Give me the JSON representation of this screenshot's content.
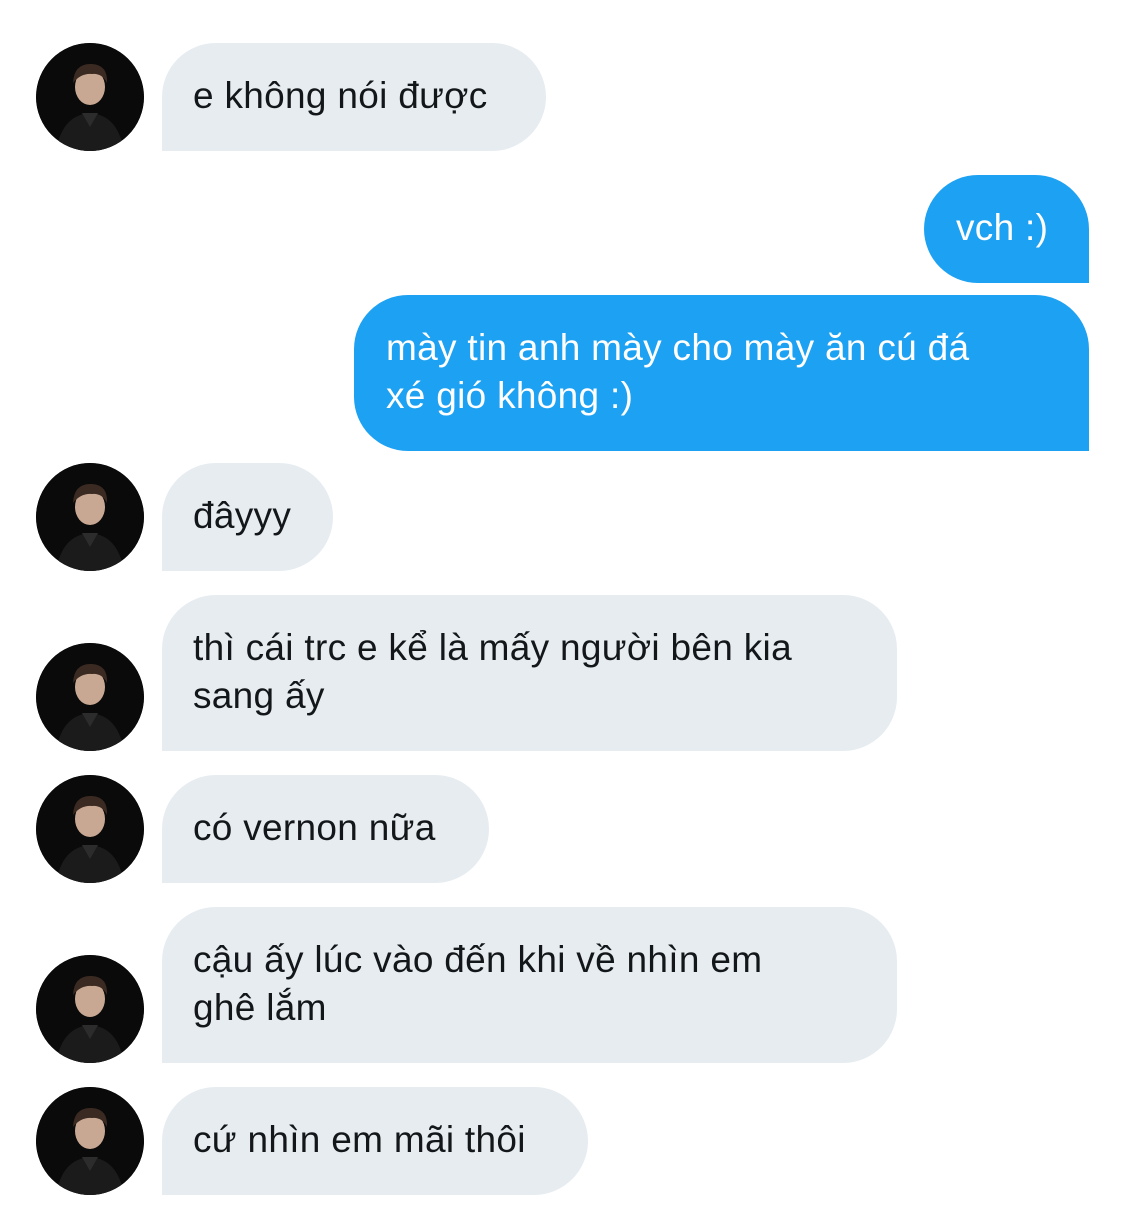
{
  "conversation": {
    "messages": [
      {
        "sender": "incoming",
        "text": "e không nói được"
      },
      {
        "sender": "outgoing",
        "text": "vch :)"
      },
      {
        "sender": "outgoing",
        "text": "mày tin anh mày cho mày ăn cú đá\nxé gió không :)"
      },
      {
        "sender": "incoming",
        "text": "đâyyy"
      },
      {
        "sender": "incoming",
        "text": "thì cái trc e kể là mấy người bên kia\nsang ấy"
      },
      {
        "sender": "incoming",
        "text": "có vernon nữa"
      },
      {
        "sender": "incoming",
        "text": "cậu ấy lúc vào đến khi về nhìn em\nghê lắm"
      },
      {
        "sender": "incoming",
        "text": "cứ nhìn em mãi thôi"
      }
    ]
  },
  "colors": {
    "incoming_bubble": "#e6ecf0",
    "outgoing_bubble": "#1da1f2",
    "incoming_text": "#14171a",
    "outgoing_text": "#ffffff"
  }
}
